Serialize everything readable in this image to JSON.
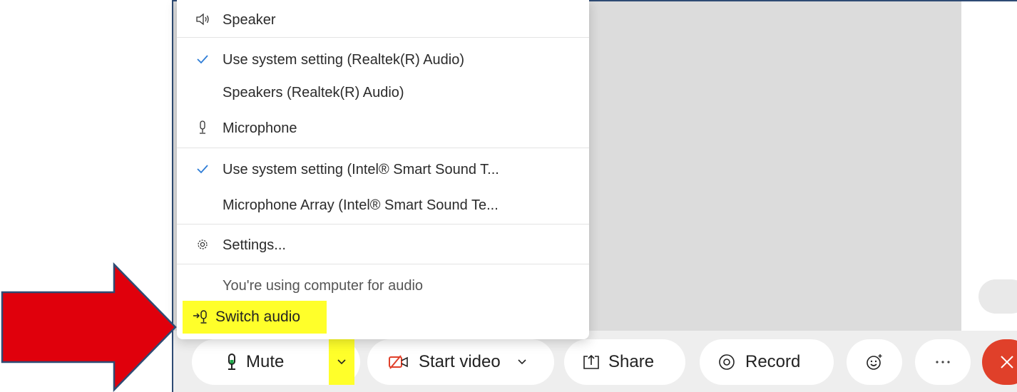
{
  "menu": {
    "speaker_header": "Speaker",
    "speaker_options": [
      {
        "label": "Use system setting (Realtek(R) Audio)",
        "checked": true
      },
      {
        "label": "Speakers (Realtek(R) Audio)",
        "checked": false
      }
    ],
    "microphone_header": "Microphone",
    "microphone_options": [
      {
        "label": "Use system setting (Intel® Smart Sound T...",
        "checked": true
      },
      {
        "label": "Microphone Array (Intel® Smart Sound Te...",
        "checked": false
      }
    ],
    "settings_label": "Settings...",
    "audio_status": "You're using computer for audio",
    "switch_audio_label": "Switch audio"
  },
  "toolbar": {
    "mute_label": "Mute",
    "start_video_label": "Start video",
    "share_label": "Share",
    "record_label": "Record"
  },
  "icons": {
    "speaker": "speaker-icon",
    "microphone": "microphone-icon",
    "settings": "gear-icon",
    "switch_audio": "switch-audio-icon",
    "checkmark": "checkmark-icon",
    "video_off": "video-off-icon",
    "share": "share-icon",
    "record": "record-icon",
    "reactions": "smiley-icon",
    "more": "more-icon",
    "end_call": "close-icon"
  },
  "colors": {
    "highlight": "#ffff2a",
    "checkmark": "#2d7cd6",
    "video_off": "#e0402a",
    "end_call": "#e0402a",
    "annotation_arrow": "#e0000c"
  }
}
